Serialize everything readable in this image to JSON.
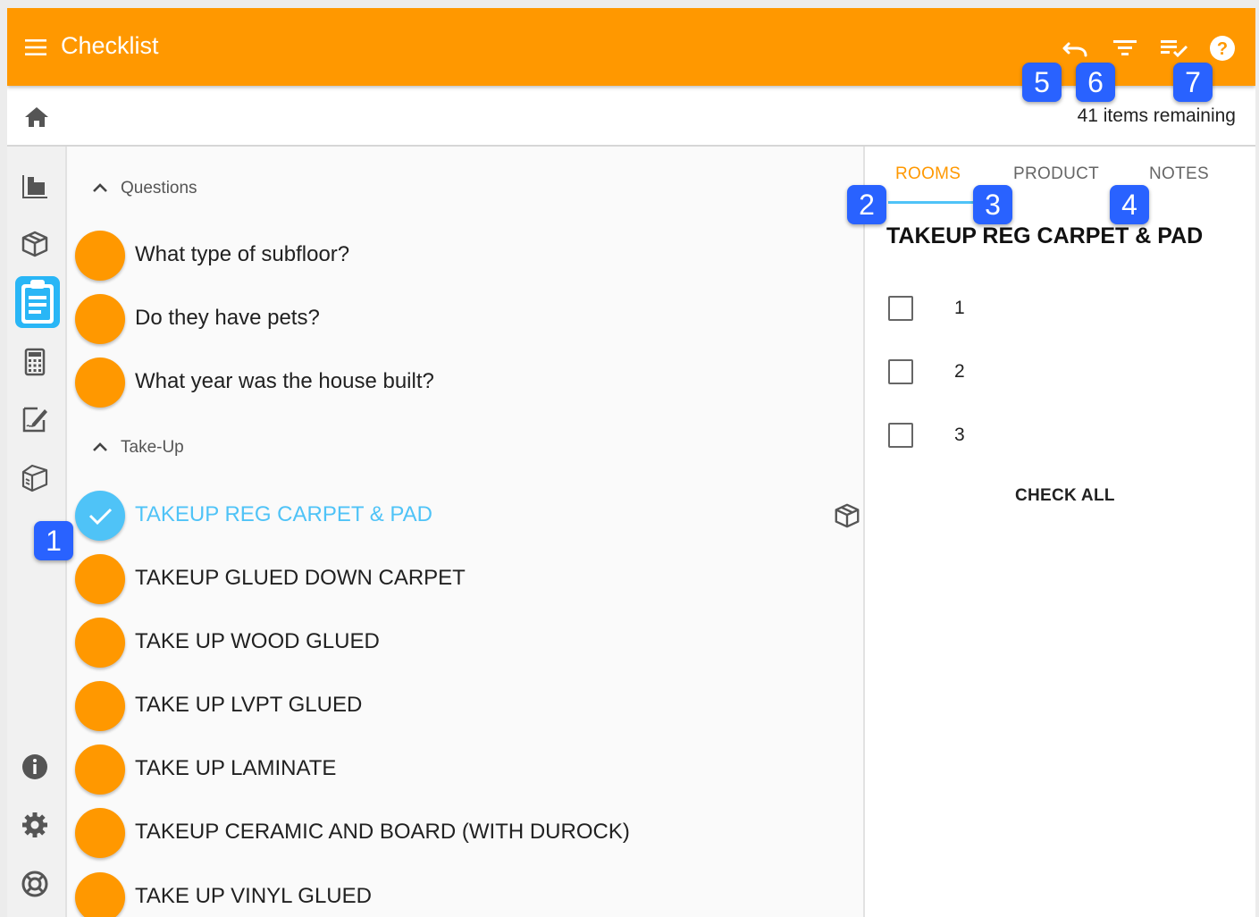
{
  "appbar": {
    "title": "Checklist",
    "icons": [
      "menu-icon",
      "undo-icon",
      "filter-icon",
      "checklist-icon",
      "help-icon"
    ]
  },
  "subbar": {
    "items_remaining": "41 items remaining"
  },
  "rail": {
    "icons": [
      "floor-plan-icon",
      "product-box-icon",
      "clipboard-icon",
      "calculator-icon",
      "edit-document-icon",
      "package-icon",
      "info-icon",
      "settings-icon",
      "lifebuoy-icon"
    ],
    "active": "clipboard-icon"
  },
  "sections": [
    {
      "title": "Questions",
      "items": [
        {
          "label": "What type of subfloor?"
        },
        {
          "label": "Do they have pets?"
        },
        {
          "label": "What year was the house built?"
        }
      ]
    },
    {
      "title": "Take-Up",
      "items": [
        {
          "label": "TAKEUP REG CARPET & PAD",
          "status": "checked"
        },
        {
          "label": "TAKEUP GLUED DOWN CARPET"
        },
        {
          "label": "TAKE UP WOOD GLUED"
        },
        {
          "label": "TAKE UP LVPT GLUED"
        },
        {
          "label": "TAKE UP LAMINATE"
        },
        {
          "label": "TAKEUP CERAMIC AND BOARD (WITH DUROCK)"
        },
        {
          "label": "TAKE UP VINYL GLUED"
        }
      ]
    }
  ],
  "panel": {
    "tabs": [
      "ROOMS",
      "PRODUCT",
      "NOTES"
    ],
    "active_tab": "ROOMS",
    "title": "TAKEUP REG CARPET & PAD",
    "rooms": [
      "1",
      "2",
      "3"
    ],
    "check_all": "CHECK ALL"
  },
  "callouts": [
    "1",
    "2",
    "3",
    "4",
    "5",
    "6",
    "7"
  ],
  "colors": {
    "primary": "#ff9800",
    "accent": "#4fc3f7",
    "callout": "#2962ff"
  }
}
